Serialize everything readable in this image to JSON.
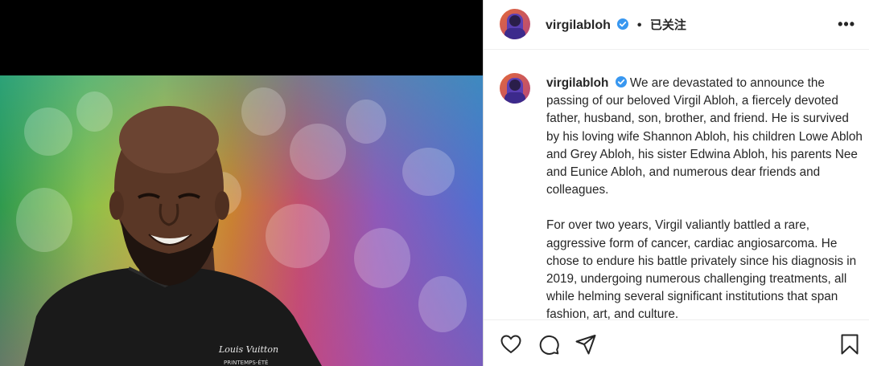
{
  "post": {
    "username": "virgilabloh",
    "verified_icon": "verified-badge-icon",
    "separator": "•",
    "follow_status": "已关注",
    "more_label": "•••",
    "caption_paragraphs": [
      "We are devastated to announce the passing of our beloved Virgil Abloh, a fiercely devoted father, husband, son, brother, and friend. He is survived by his loving wife Shannon Abloh, his children Lowe Abloh and Grey Abloh, his sister Edwina Abloh, his parents Nee and Eunice Abloh, and numerous dear friends and colleagues.",
      "For over two years, Virgil valiantly battled a rare, aggressive form of cancer, cardiac angiosarcoma. He chose to endure his battle privately since his diagnosis in 2019, undergoing numerous challenging treatments, all while helming several significant institutions that span fashion, art, and culture."
    ]
  },
  "actions": {
    "like_icon": "heart-icon",
    "comment_icon": "comment-icon",
    "share_icon": "share-icon",
    "save_icon": "bookmark-icon"
  },
  "colors": {
    "text": "#262626",
    "border": "#dbdbdb",
    "verified": "#3897f0"
  }
}
